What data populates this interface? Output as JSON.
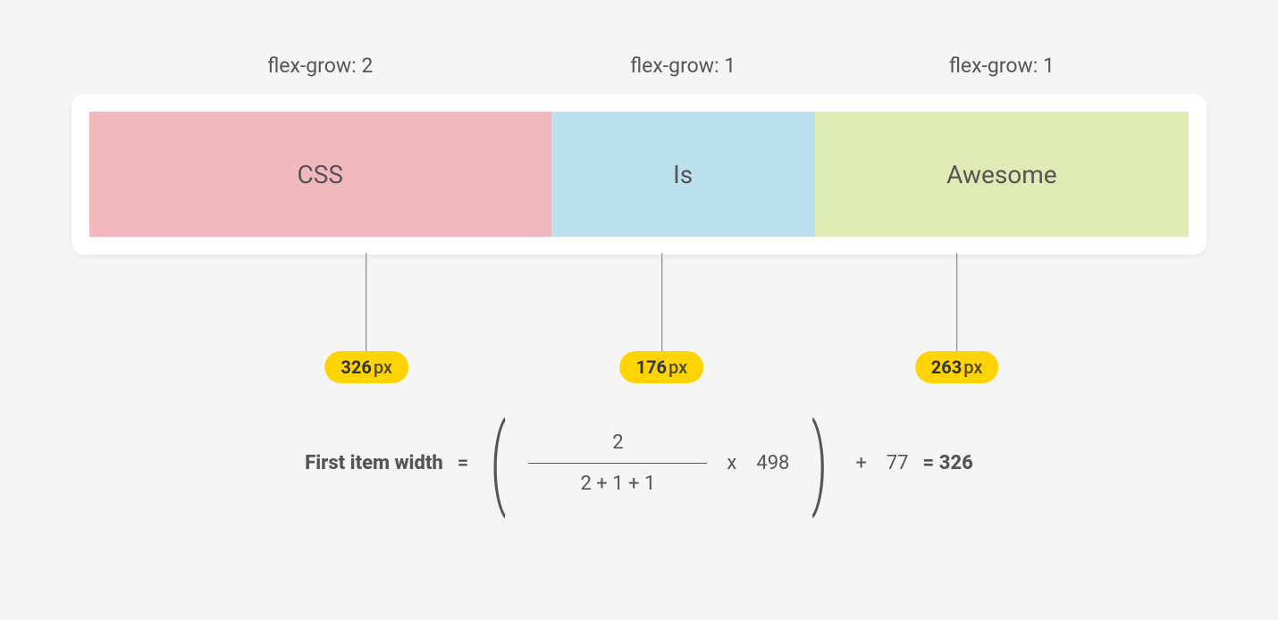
{
  "labels": {
    "item1": "flex-grow: 2",
    "item2": "flex-grow: 1",
    "item3": "flex-grow: 1"
  },
  "items": {
    "item1": "CSS",
    "item2": "Is",
    "item3": "Awesome"
  },
  "widths": {
    "item1": {
      "value": "326",
      "unit": "px"
    },
    "item2": {
      "value": "176",
      "unit": "px"
    },
    "item3": {
      "value": "263",
      "unit": "px"
    }
  },
  "formula": {
    "label": "First item width",
    "eq1": "=",
    "fraction_numerator": "2",
    "fraction_denominator": "2 + 1 + 1",
    "multiply_sign": "x",
    "multiplier": "498",
    "plus_sign": "+",
    "addend": "77",
    "eq2": "=",
    "result": "326"
  }
}
